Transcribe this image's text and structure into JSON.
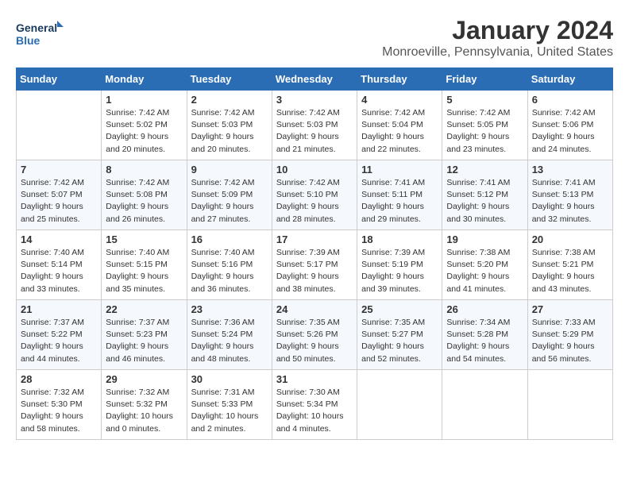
{
  "header": {
    "logo_line1": "General",
    "logo_line2": "Blue",
    "month": "January 2024",
    "location": "Monroeville, Pennsylvania, United States"
  },
  "weekdays": [
    "Sunday",
    "Monday",
    "Tuesday",
    "Wednesday",
    "Thursday",
    "Friday",
    "Saturday"
  ],
  "weeks": [
    [
      {
        "day": "",
        "info": ""
      },
      {
        "day": "1",
        "info": "Sunrise: 7:42 AM\nSunset: 5:02 PM\nDaylight: 9 hours\nand 20 minutes."
      },
      {
        "day": "2",
        "info": "Sunrise: 7:42 AM\nSunset: 5:03 PM\nDaylight: 9 hours\nand 20 minutes."
      },
      {
        "day": "3",
        "info": "Sunrise: 7:42 AM\nSunset: 5:03 PM\nDaylight: 9 hours\nand 21 minutes."
      },
      {
        "day": "4",
        "info": "Sunrise: 7:42 AM\nSunset: 5:04 PM\nDaylight: 9 hours\nand 22 minutes."
      },
      {
        "day": "5",
        "info": "Sunrise: 7:42 AM\nSunset: 5:05 PM\nDaylight: 9 hours\nand 23 minutes."
      },
      {
        "day": "6",
        "info": "Sunrise: 7:42 AM\nSunset: 5:06 PM\nDaylight: 9 hours\nand 24 minutes."
      }
    ],
    [
      {
        "day": "7",
        "info": "Sunrise: 7:42 AM\nSunset: 5:07 PM\nDaylight: 9 hours\nand 25 minutes."
      },
      {
        "day": "8",
        "info": "Sunrise: 7:42 AM\nSunset: 5:08 PM\nDaylight: 9 hours\nand 26 minutes."
      },
      {
        "day": "9",
        "info": "Sunrise: 7:42 AM\nSunset: 5:09 PM\nDaylight: 9 hours\nand 27 minutes."
      },
      {
        "day": "10",
        "info": "Sunrise: 7:42 AM\nSunset: 5:10 PM\nDaylight: 9 hours\nand 28 minutes."
      },
      {
        "day": "11",
        "info": "Sunrise: 7:41 AM\nSunset: 5:11 PM\nDaylight: 9 hours\nand 29 minutes."
      },
      {
        "day": "12",
        "info": "Sunrise: 7:41 AM\nSunset: 5:12 PM\nDaylight: 9 hours\nand 30 minutes."
      },
      {
        "day": "13",
        "info": "Sunrise: 7:41 AM\nSunset: 5:13 PM\nDaylight: 9 hours\nand 32 minutes."
      }
    ],
    [
      {
        "day": "14",
        "info": "Sunrise: 7:40 AM\nSunset: 5:14 PM\nDaylight: 9 hours\nand 33 minutes."
      },
      {
        "day": "15",
        "info": "Sunrise: 7:40 AM\nSunset: 5:15 PM\nDaylight: 9 hours\nand 35 minutes."
      },
      {
        "day": "16",
        "info": "Sunrise: 7:40 AM\nSunset: 5:16 PM\nDaylight: 9 hours\nand 36 minutes."
      },
      {
        "day": "17",
        "info": "Sunrise: 7:39 AM\nSunset: 5:17 PM\nDaylight: 9 hours\nand 38 minutes."
      },
      {
        "day": "18",
        "info": "Sunrise: 7:39 AM\nSunset: 5:19 PM\nDaylight: 9 hours\nand 39 minutes."
      },
      {
        "day": "19",
        "info": "Sunrise: 7:38 AM\nSunset: 5:20 PM\nDaylight: 9 hours\nand 41 minutes."
      },
      {
        "day": "20",
        "info": "Sunrise: 7:38 AM\nSunset: 5:21 PM\nDaylight: 9 hours\nand 43 minutes."
      }
    ],
    [
      {
        "day": "21",
        "info": "Sunrise: 7:37 AM\nSunset: 5:22 PM\nDaylight: 9 hours\nand 44 minutes."
      },
      {
        "day": "22",
        "info": "Sunrise: 7:37 AM\nSunset: 5:23 PM\nDaylight: 9 hours\nand 46 minutes."
      },
      {
        "day": "23",
        "info": "Sunrise: 7:36 AM\nSunset: 5:24 PM\nDaylight: 9 hours\nand 48 minutes."
      },
      {
        "day": "24",
        "info": "Sunrise: 7:35 AM\nSunset: 5:26 PM\nDaylight: 9 hours\nand 50 minutes."
      },
      {
        "day": "25",
        "info": "Sunrise: 7:35 AM\nSunset: 5:27 PM\nDaylight: 9 hours\nand 52 minutes."
      },
      {
        "day": "26",
        "info": "Sunrise: 7:34 AM\nSunset: 5:28 PM\nDaylight: 9 hours\nand 54 minutes."
      },
      {
        "day": "27",
        "info": "Sunrise: 7:33 AM\nSunset: 5:29 PM\nDaylight: 9 hours\nand 56 minutes."
      }
    ],
    [
      {
        "day": "28",
        "info": "Sunrise: 7:32 AM\nSunset: 5:30 PM\nDaylight: 9 hours\nand 58 minutes."
      },
      {
        "day": "29",
        "info": "Sunrise: 7:32 AM\nSunset: 5:32 PM\nDaylight: 10 hours\nand 0 minutes."
      },
      {
        "day": "30",
        "info": "Sunrise: 7:31 AM\nSunset: 5:33 PM\nDaylight: 10 hours\nand 2 minutes."
      },
      {
        "day": "31",
        "info": "Sunrise: 7:30 AM\nSunset: 5:34 PM\nDaylight: 10 hours\nand 4 minutes."
      },
      {
        "day": "",
        "info": ""
      },
      {
        "day": "",
        "info": ""
      },
      {
        "day": "",
        "info": ""
      }
    ]
  ]
}
